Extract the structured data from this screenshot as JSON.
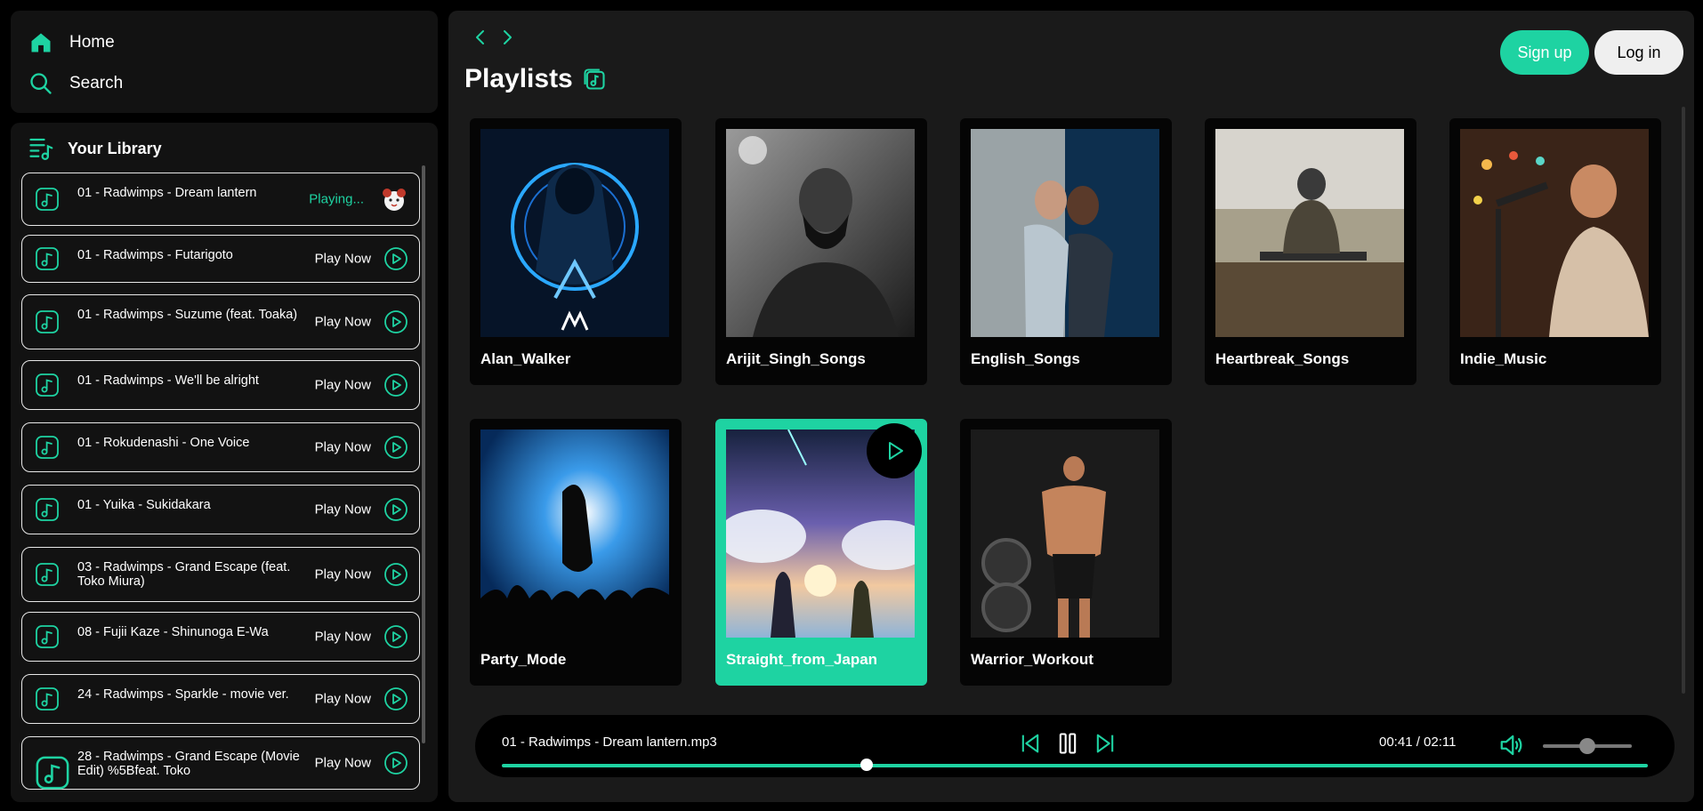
{
  "colors": {
    "accent": "#1ed3a2",
    "panel": "#121212",
    "main": "#1a1a1a",
    "bg": "#000000"
  },
  "nav": {
    "home": {
      "label": "Home",
      "icon": "home-icon"
    },
    "search": {
      "label": "Search",
      "icon": "search-icon"
    }
  },
  "library": {
    "title": "Your Library",
    "icon": "library-icon",
    "songs": [
      {
        "title": "01 - Radwimps - Dream lantern",
        "action": "Playing...",
        "playing": true
      },
      {
        "title": "01 - Radwimps - Futarigoto",
        "action": "Play Now"
      },
      {
        "title": "01 - Radwimps - Suzume (feat. Toaka)",
        "action": "Play Now"
      },
      {
        "title": "01 - Radwimps - We'll be alright",
        "action": "Play Now"
      },
      {
        "title": "01 - Rokudenashi - One Voice",
        "action": "Play Now"
      },
      {
        "title": "01 - Yuika - Sukidakara",
        "action": "Play Now"
      },
      {
        "title": "03 - Radwimps - Grand Escape (feat. Toko Miura)",
        "action": "Play Now"
      },
      {
        "title": "08 - Fujii Kaze - Shinunoga E-Wa",
        "action": "Play Now"
      },
      {
        "title": "24 - Radwimps - Sparkle - movie ver.",
        "action": "Play Now"
      },
      {
        "title": "28 - Radwimps - Grand Escape (Movie Edit) %5Bfeat. Toko",
        "action": "Play Now"
      }
    ]
  },
  "header": {
    "title": "Playlists",
    "signup_label": "Sign up",
    "login_label": "Log in"
  },
  "playlists": [
    {
      "name": "Alan_Walker"
    },
    {
      "name": "Arijit_Singh_Songs"
    },
    {
      "name": "English_Songs"
    },
    {
      "name": "Heartbreak_Songs"
    },
    {
      "name": "Indie_Music"
    },
    {
      "name": "Party_Mode"
    },
    {
      "name": "Straight_from_Japan",
      "active": true
    },
    {
      "name": "Warrior_Workout"
    }
  ],
  "player": {
    "track": "01 - Radwimps - Dream lantern.mp3",
    "time": "00:41 / 02:11",
    "progress": 0.3186,
    "volume": 0.5,
    "state": "playing"
  }
}
